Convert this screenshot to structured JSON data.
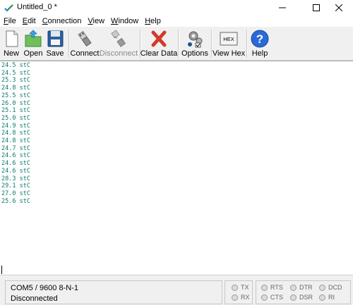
{
  "window": {
    "title": "Untitled_0 *"
  },
  "menu": [
    "File",
    "Edit",
    "Connection",
    "View",
    "Window",
    "Help"
  ],
  "menu_accel": [
    "F",
    "E",
    "C",
    "V",
    "W",
    "H"
  ],
  "toolbar": {
    "new": "New",
    "open": "Open",
    "save": "Save",
    "connect": "Connect",
    "disconnect": "Disconnect",
    "clear": "Clear Data",
    "options": "Options",
    "viewhex": "View Hex",
    "hex_icon_text": "HEX",
    "help": "Help"
  },
  "terminal": {
    "lines": [
      "24.5 stC",
      "24.5 stC",
      "25.3 stC",
      "24.8 stC",
      "25.5 stC",
      "26.0 stC",
      "25.1 stC",
      "25.0 stC",
      "24.9 stC",
      "24.8 stC",
      "24.8 stC",
      "24.7 stC",
      "24.6 stC",
      "24.6 stC",
      "24.6 stC",
      "28.3 stC",
      "29.1 stC",
      "27.0 stC",
      "25.6 stC"
    ]
  },
  "status": {
    "port": "COM5 / 9600 8-N-1",
    "connection": "Disconnected",
    "signals": {
      "tx": "TX",
      "rx": "RX",
      "rts": "RTS",
      "cts": "CTS",
      "dtr": "DTR",
      "dsr": "DSR",
      "dcd": "DCD",
      "ri": "RI"
    }
  },
  "colors": {
    "terminal_text": "#0b7a6e",
    "help_blue": "#2b6ad6",
    "clear_red": "#d33a2c"
  }
}
